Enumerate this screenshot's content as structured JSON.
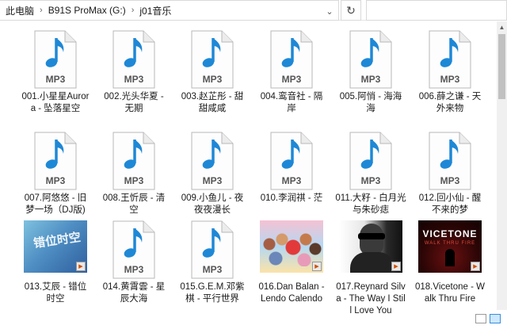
{
  "breadcrumb": [
    "此电脑",
    "B91S ProMax (G:)",
    "j01音乐"
  ],
  "colors": {
    "accent": "#3a8ed8",
    "mp3_blue": "#1e88d6"
  },
  "icons": {
    "mp3": "mp3-file-icon",
    "refresh": "refresh-icon",
    "dropdown": "chevron-down-icon"
  },
  "mp3_label": "MP3",
  "files": [
    {
      "name": "001.小星星Aurora - 坠落星空",
      "type": "mp3"
    },
    {
      "name": "002.光头华夏 - 无期",
      "type": "mp3"
    },
    {
      "name": "003.赵芷彤 - 甜甜咸咸",
      "type": "mp3"
    },
    {
      "name": "004.鸾音社 - 隔岸",
      "type": "mp3"
    },
    {
      "name": "005.阿悄 - 海海海",
      "type": "mp3"
    },
    {
      "name": "006.薛之谦 - 天外来物",
      "type": "mp3"
    },
    {
      "name": "007.阿悠悠 - 旧梦一场（DJ版)",
      "type": "mp3"
    },
    {
      "name": "008.王忻辰 - 清空",
      "type": "mp3"
    },
    {
      "name": "009.小鱼儿 - 夜夜夜漫长",
      "type": "mp3"
    },
    {
      "name": "010.李润祺 - 茫",
      "type": "mp3"
    },
    {
      "name": "011.大籽 - 白月光与朱砂痣",
      "type": "mp3"
    },
    {
      "name": "012.回小仙 - 醒不来的梦",
      "type": "mp3"
    },
    {
      "name": "013.艾辰 - 错位时空",
      "type": "cover",
      "cover_text": "错位时空"
    },
    {
      "name": "014.黄霄雲 - 星辰大海",
      "type": "mp3"
    },
    {
      "name": "015.G.E.M.邓紫棋 - 平行世界",
      "type": "mp3"
    },
    {
      "name": "016.Dan Balan - Lendo Calendo",
      "type": "cover"
    },
    {
      "name": "017.Reynard Silva - The Way I Still Love You",
      "type": "cover"
    },
    {
      "name": "018.Vicetone - Walk Thru Fire",
      "type": "cover",
      "cover_text": "VICETONE",
      "cover_sub": "WALK THRU FIRE"
    }
  ]
}
